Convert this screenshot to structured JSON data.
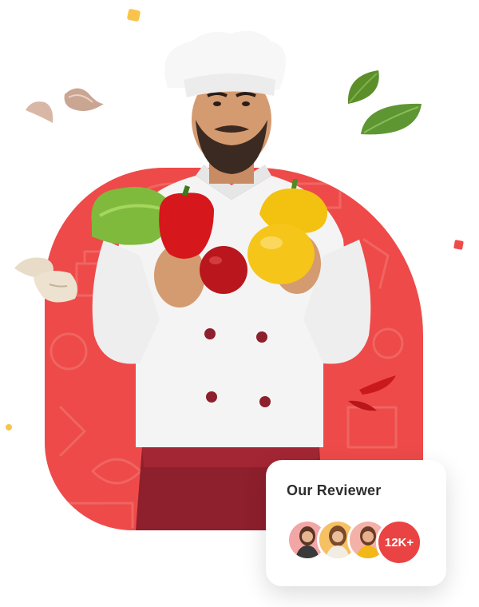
{
  "colors": {
    "accent_red": "#ee4a4a",
    "badge_red": "#ea4343",
    "confetti_yellow": "#f9c44b",
    "card_bg": "#ffffff",
    "title_text": "#2d2d2d"
  },
  "hero": {
    "image": "chef-holding-vegetables-image",
    "garnishes": [
      "garlic-icon",
      "basil-leaf-icon",
      "mushroom-icon",
      "chili-pepper-icon"
    ]
  },
  "reviewer_card": {
    "title": "Our Reviewer",
    "avatars": [
      "reviewer-avatar-1",
      "reviewer-avatar-2",
      "reviewer-avatar-3"
    ],
    "count": "12K+"
  }
}
